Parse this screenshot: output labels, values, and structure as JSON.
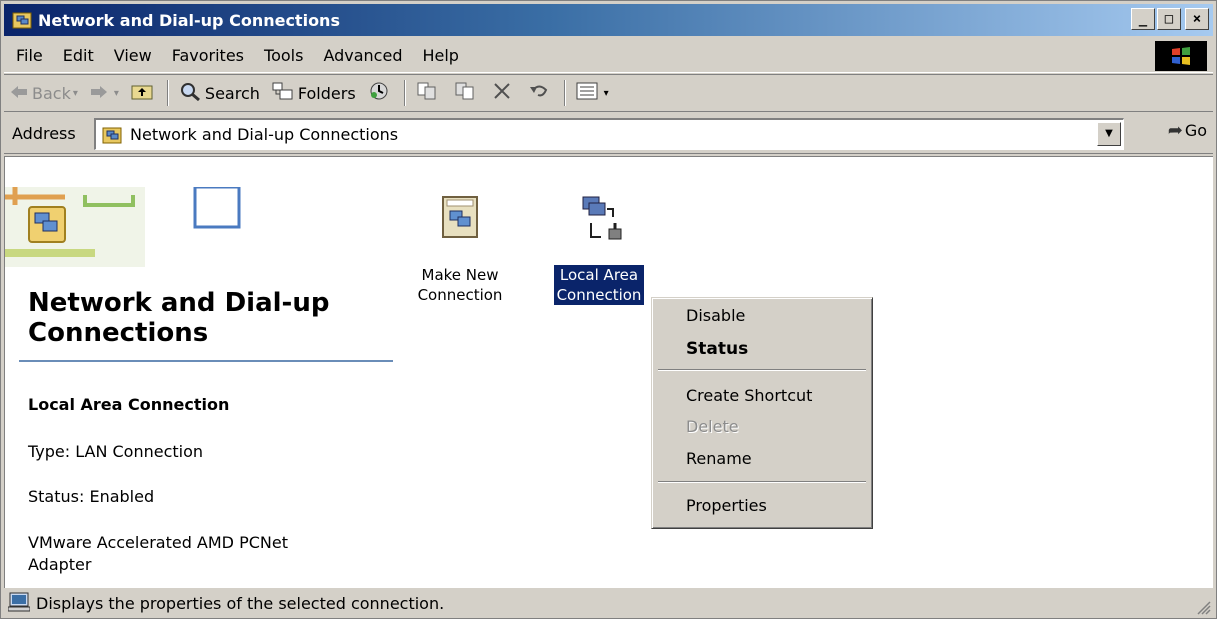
{
  "window": {
    "title": "Network and Dial-up Connections",
    "buttons": {
      "minimize": "_",
      "maximize": "□",
      "close": "×"
    }
  },
  "menubar": {
    "items": [
      "File",
      "Edit",
      "View",
      "Favorites",
      "Tools",
      "Advanced",
      "Help"
    ]
  },
  "toolbar": {
    "back_label": "Back",
    "search_label": "Search",
    "folders_label": "Folders",
    "icons": [
      "back-arrow-icon",
      "forward-arrow-icon",
      "up-folder-icon",
      "search-icon",
      "folders-icon",
      "history-icon",
      "move-to-icon",
      "copy-to-icon",
      "delete-icon",
      "undo-icon",
      "views-icon"
    ]
  },
  "address": {
    "label": "Address",
    "value": "Network and Dial-up Connections",
    "go_label": "Go"
  },
  "left_pane": {
    "title": "Network and Dial-up Connections",
    "selected_name": "Local Area Connection",
    "type": "Type: LAN Connection",
    "status": "Status: Enabled",
    "adapter_line1": "VMware Accelerated AMD PCNet",
    "adapter_line2": "Adapter"
  },
  "icons": {
    "make_new": {
      "line1": "Make New",
      "line2": "Connection"
    },
    "local_area": {
      "line1": "Local Area",
      "line2": "Connection"
    }
  },
  "context_menu": {
    "disable": "Disable",
    "status": "Status",
    "create_shortcut": "Create Shortcut",
    "delete": "Delete",
    "rename": "Rename",
    "properties": "Properties"
  },
  "statusbar": {
    "text": "Displays the properties of the selected connection."
  },
  "colors": {
    "titlebar_start": "#0a246a",
    "titlebar_end": "#a6caf0",
    "window_face": "#d4d0c8",
    "selection": "#0a246a"
  }
}
